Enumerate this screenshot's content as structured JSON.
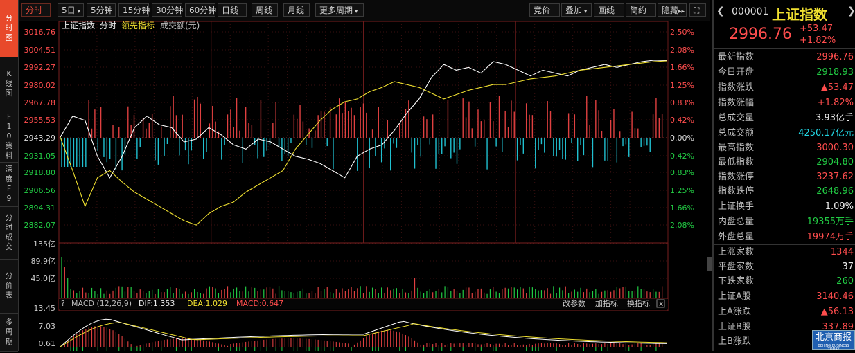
{
  "nav": {
    "tabs": [
      {
        "label": "分时图",
        "active": true
      },
      {
        "label": "K线图",
        "active": false
      },
      {
        "label": "F10资料",
        "active": false
      },
      {
        "label": "深度F9",
        "active": false
      },
      {
        "label": "分时成交",
        "active": false
      },
      {
        "label": "分价表",
        "active": false
      },
      {
        "label": "多周期",
        "active": false
      }
    ]
  },
  "toolbar": {
    "left": [
      "分时",
      "5日",
      "5分钟",
      "15分钟",
      "30分钟",
      "60分钟",
      "日线",
      "周线",
      "月线",
      "更多周期"
    ],
    "right": [
      "竞价",
      "叠加",
      "画线",
      "简约",
      "隐藏"
    ]
  },
  "chart": {
    "legend": {
      "name": "上证指数",
      "mode": "分时",
      "lead": "领先指标",
      "vol": "成交额(元)"
    },
    "price_ticks": [
      "3016.76",
      "3004.51",
      "2992.27",
      "2980.02",
      "2967.78",
      "2955.53",
      "2943.29",
      "2931.05",
      "2918.80",
      "2906.56",
      "2894.31",
      "2882.07"
    ],
    "pct_ticks": [
      "2.50%",
      "2.08%",
      "1.66%",
      "1.25%",
      "0.83%",
      "0.42%",
      "0.00%",
      "0.42%",
      "0.83%",
      "1.25%",
      "1.66%",
      "2.08%"
    ],
    "vol_ticks": [
      "135亿",
      "89.9亿",
      "45.0亿"
    ],
    "macd": {
      "help": "?",
      "title": "MACD (12,26,9)",
      "dif": "DIF:1.353",
      "dea": "DEA:1.029",
      "macd": "MACD:0.647",
      "buttons": [
        "改参数",
        "加指标",
        "换指标"
      ],
      "ticks": [
        "13.45",
        "7.03",
        "0.61"
      ]
    }
  },
  "chart_data": {
    "type": "line",
    "title": "上证指数 分时",
    "ylim": [
      2882.07,
      3016.76
    ],
    "series": [
      {
        "name": "上证指数",
        "values": [
          2943.3,
          2958,
          2955,
          2930,
          2915,
          2930,
          2950,
          2958,
          2952,
          2950,
          2940,
          2942,
          2950,
          2945,
          2938,
          2935,
          2942,
          2940,
          2935,
          2930,
          2928,
          2925,
          2920,
          2915,
          2930,
          2935,
          2938,
          2948,
          2960,
          2970,
          2985,
          2994,
          2990,
          2992,
          2988,
          2996,
          2994,
          2990,
          2986,
          2990,
          2988,
          2986,
          2990,
          2992,
          2994,
          2992,
          2994,
          2996,
          2997,
          2996.76
        ]
      },
      {
        "name": "领先指标",
        "values": [
          2943.3,
          2920,
          2895,
          2915,
          2920,
          2912,
          2905,
          2900,
          2895,
          2890,
          2885,
          2882,
          2890,
          2895,
          2898,
          2905,
          2910,
          2915,
          2920,
          2935,
          2945,
          2955,
          2963,
          2968,
          2970,
          2975,
          2978,
          2982,
          2980,
          2978,
          2974,
          2970,
          2973,
          2976,
          2978,
          2980,
          2980,
          2982,
          2984,
          2985,
          2986,
          2988,
          2990,
          2991,
          2992,
          2993,
          2994,
          2995,
          2996,
          2996.5
        ]
      }
    ]
  },
  "quote": {
    "code": "000001",
    "name": "上证指数",
    "price": "2996.76",
    "change": "+53.47",
    "pct": "+1.82%"
  },
  "stats": [
    {
      "label": "最新指数",
      "value": "2996.76",
      "color": "red"
    },
    {
      "label": "今日开盘",
      "value": "2918.93",
      "color": "green"
    },
    {
      "label": "指数涨跌",
      "value": "▲53.47",
      "color": "red"
    },
    {
      "label": "指数涨幅",
      "value": "+1.82%",
      "color": "red"
    },
    {
      "label": "总成交量",
      "value": "3.93亿手",
      "color": "white"
    },
    {
      "label": "总成交额",
      "value": "4250.17亿元",
      "color": "cyan"
    },
    {
      "label": "最高指数",
      "value": "3000.30",
      "color": "red"
    },
    {
      "label": "最低指数",
      "value": "2904.80",
      "color": "green"
    },
    {
      "label": "指数涨停",
      "value": "3237.62",
      "color": "red"
    },
    {
      "label": "指数跌停",
      "value": "2648.96",
      "color": "green"
    },
    {
      "label": "上证换手",
      "value": "1.09%",
      "color": "white"
    },
    {
      "label": "内盘总量",
      "value": "19355万手",
      "color": "green"
    },
    {
      "label": "外盘总量",
      "value": "19974万手",
      "color": "red"
    },
    {
      "label": "上涨家数",
      "value": "1344",
      "color": "red"
    },
    {
      "label": "平盘家数",
      "value": "37",
      "color": "white"
    },
    {
      "label": "下跌家数",
      "value": "260",
      "color": "green"
    },
    {
      "label": "上证A股",
      "value": "3140.46",
      "color": "red"
    },
    {
      "label": "上A涨跌",
      "value": "▲56.13",
      "color": "red"
    },
    {
      "label": "上证B股",
      "value": "337.89",
      "color": "red"
    },
    {
      "label": "上B涨跌",
      "value": "",
      "color": "red"
    }
  ],
  "logo": {
    "text": "北京商报",
    "sub": "BEIJING BUSINESS TODAY"
  },
  "colors": {
    "accent": "#e8492b",
    "up": "#ff4d4d",
    "down": "#22cc44",
    "line_index": "#ffffff",
    "line_lead": "#f0e030"
  }
}
